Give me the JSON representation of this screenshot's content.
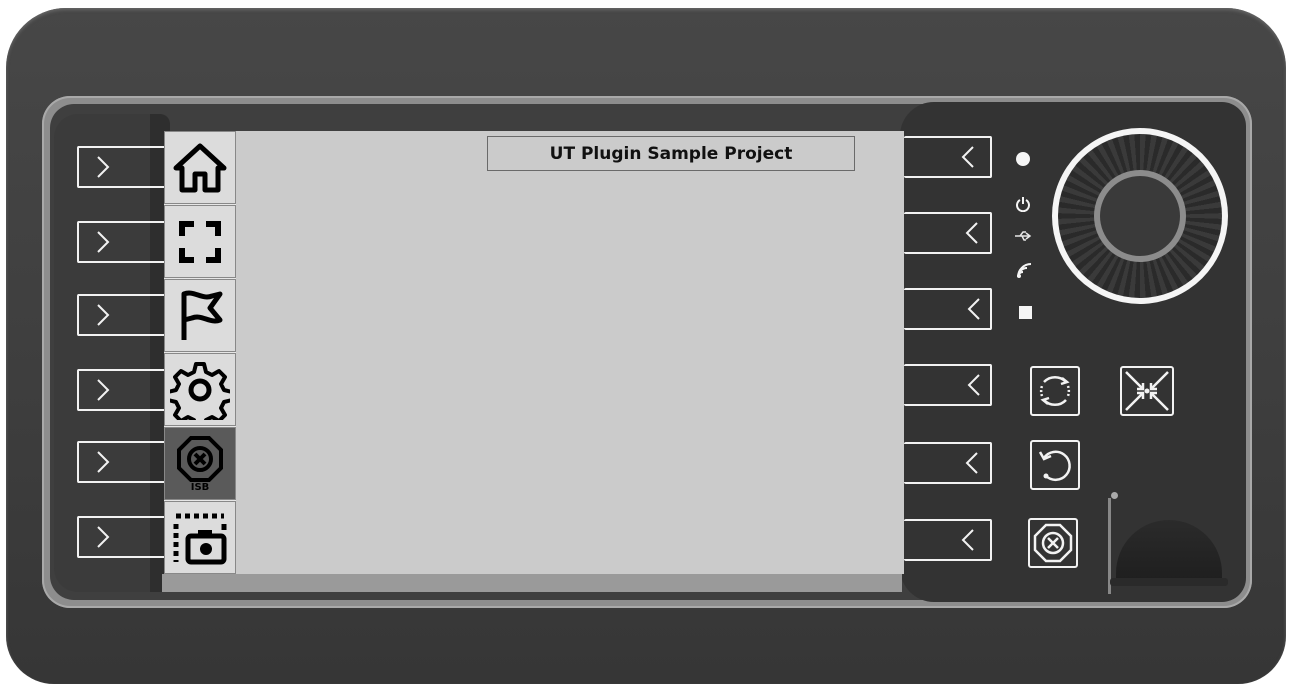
{
  "screen": {
    "title": "UT Plugin Sample Project"
  },
  "softkeys": [
    {
      "name": "home-icon"
    },
    {
      "name": "fullscreen-icon"
    },
    {
      "name": "flag-icon"
    },
    {
      "name": "settings-gear-icon"
    },
    {
      "name": "isb-stop-icon",
      "label": "ISB"
    },
    {
      "name": "screenshot-camera-icon"
    }
  ],
  "left_function_keys": 6,
  "right_function_keys": 6,
  "indicators": [
    "status-led-icon",
    "power-icon",
    "usb-icon",
    "wireless-icon",
    "square-indicator-icon"
  ],
  "hardware_buttons": [
    "rotate-button",
    "cross-arrows-button",
    "undo-button",
    "stop-button"
  ],
  "colors": {
    "housing": "#404040",
    "screen": "#cbcbcb",
    "softkey_bg": "#dcdcdc",
    "isb_bg": "#5a5a5a",
    "key_outline": "#f2f2f2"
  }
}
